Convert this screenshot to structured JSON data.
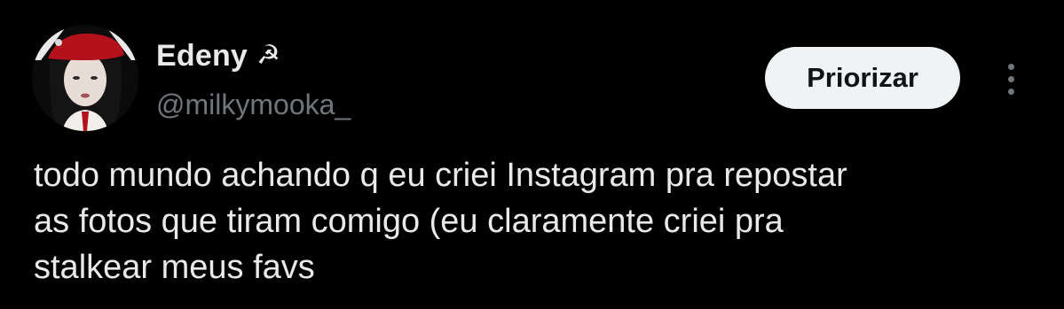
{
  "author": {
    "display_name": "Edeny",
    "name_emoji": "☭",
    "handle": "@milkymooka_",
    "avatar_icon": "profile-photo"
  },
  "actions": {
    "prioritize_label": "Priorizar",
    "more_icon": "more-vertical-icon"
  },
  "tweet": {
    "lines": [
      "todo mundo achando q eu criei Instagram pra repostar",
      "as fotos que tiram comigo (eu claramente criei pra",
      "stalkear meus favs"
    ]
  },
  "colors": {
    "background": "#000000",
    "primary_text": "#e7e9ea",
    "secondary_text": "#71767b",
    "button_bg": "#eff3f4",
    "button_text": "#0f1419",
    "beret_red": "#b3121d"
  }
}
